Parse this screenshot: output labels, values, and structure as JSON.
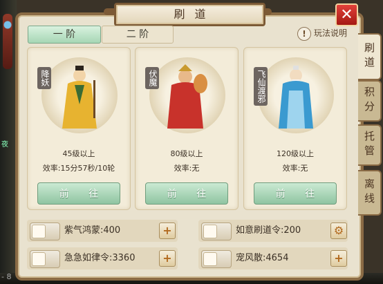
{
  "window": {
    "title": "刷道",
    "close_icon": "close-icon"
  },
  "tier_tabs": [
    {
      "label": "一 阶",
      "active": true
    },
    {
      "label": "二 阶",
      "active": false
    }
  ],
  "help": {
    "label": "玩法说明"
  },
  "side_tabs": [
    {
      "label": "刷道",
      "active": true
    },
    {
      "label": "积分",
      "active": false
    },
    {
      "label": "托管",
      "active": false
    },
    {
      "label": "离线",
      "active": false
    }
  ],
  "cards": [
    {
      "banner": "降妖",
      "level": "45级以上",
      "efficiency": "效率:15分57秒/10轮",
      "button": "前 往",
      "robe": "#e7b330"
    },
    {
      "banner": "伏魔",
      "level": "80级以上",
      "efficiency": "效率:无",
      "button": "前 往",
      "robe": "#c8322b"
    },
    {
      "banner": "飞仙渡邪",
      "level": "120级以上",
      "efficiency": "效率:无",
      "button": "前 往",
      "robe": "#3a9ad0"
    }
  ],
  "items": [
    {
      "label": "紫气鸿蒙:400",
      "icon": "plus-icon",
      "glyph": "+"
    },
    {
      "label": "如意刷道令:200",
      "icon": "gear-icon",
      "glyph": "⚙"
    },
    {
      "label": "急急如律令:3360",
      "icon": "plus-icon",
      "glyph": "+"
    },
    {
      "label": "宠风散:4654",
      "icon": "plus-icon",
      "glyph": "+"
    }
  ],
  "background": {
    "left_text": "夜",
    "bottom_text": "- 8"
  }
}
